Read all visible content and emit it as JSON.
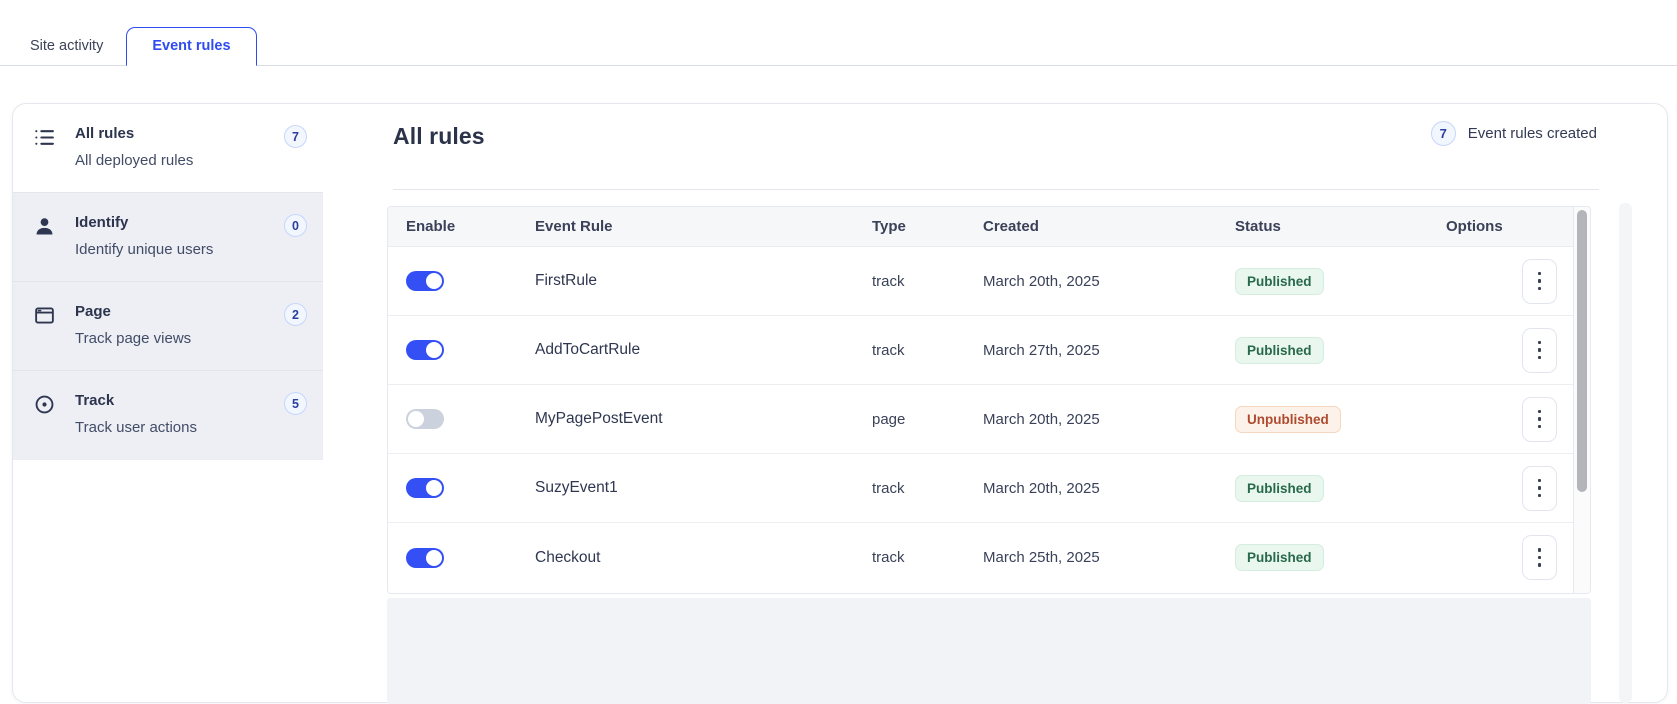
{
  "tabs": {
    "items": [
      {
        "label": "Site activity",
        "active": false
      },
      {
        "label": "Event rules",
        "active": true
      }
    ]
  },
  "sidebar": {
    "items": [
      {
        "icon": "list-icon",
        "title": "All rules",
        "subtitle": "All deployed rules",
        "count": "7",
        "active": true
      },
      {
        "icon": "user-icon",
        "title": "Identify",
        "subtitle": "Identify unique users",
        "count": "0",
        "active": false
      },
      {
        "icon": "window-icon",
        "title": "Page",
        "subtitle": "Track page views",
        "count": "2",
        "active": false
      },
      {
        "icon": "target-icon",
        "title": "Track",
        "subtitle": "Track user actions",
        "count": "5",
        "active": false
      }
    ]
  },
  "main": {
    "title": "All rules",
    "created_count": "7",
    "created_label": "Event rules created"
  },
  "table": {
    "columns": [
      "Enable",
      "Event Rule",
      "Type",
      "Created",
      "Status",
      "Options"
    ],
    "rows": [
      {
        "enabled": true,
        "name": "FirstRule",
        "type": "track",
        "created": "March 20th, 2025",
        "status": "Published"
      },
      {
        "enabled": true,
        "name": "AddToCartRule",
        "type": "track",
        "created": "March 27th, 2025",
        "status": "Published"
      },
      {
        "enabled": false,
        "name": "MyPagePostEvent",
        "type": "page",
        "created": "March 20th, 2025",
        "status": "Unpublished"
      },
      {
        "enabled": true,
        "name": "SuzyEvent1",
        "type": "track",
        "created": "March 20th, 2025",
        "status": "Published"
      },
      {
        "enabled": true,
        "name": "Checkout",
        "type": "track",
        "created": "March 25th, 2025",
        "status": "Published"
      }
    ]
  },
  "colors": {
    "accent": "#2e4cf0",
    "toggle_on": "#3450f5",
    "toggle_off": "#ccd2dd",
    "published_bg": "#e9f7ee",
    "published_border": "#d5edde",
    "published_text": "#28694b",
    "unpublished_bg": "#fdf2ea",
    "unpublished_border": "#f3d7c0",
    "unpublished_text": "#ad4b2e",
    "count_badge_border": "#c7d6fa",
    "count_badge_bg": "#f2f6ff",
    "count_badge_text": "#2b3f9e",
    "heading_text": "#2b3349",
    "body_text": "#323a52",
    "muted_text": "#424c66",
    "sidebar_item_bg": "#edeff5",
    "table_header_bg": "#f6f7f9",
    "border": "#e6e9ef",
    "scrollbar_thumb": "#b3b5ba"
  }
}
